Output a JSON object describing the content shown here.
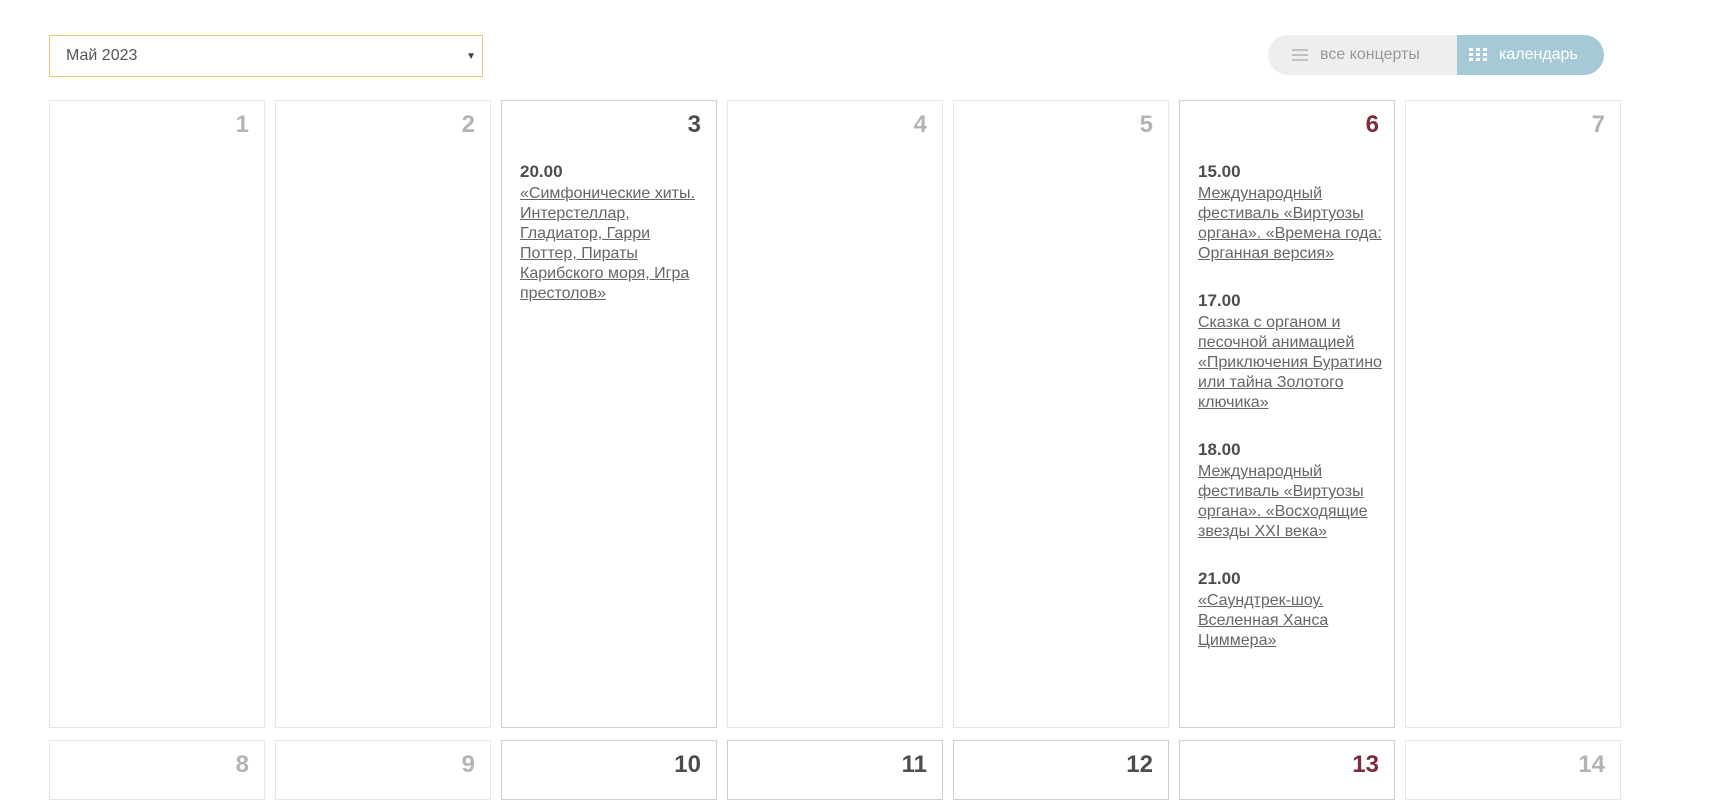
{
  "filter": {
    "month_value": "Май 2023"
  },
  "view_toggle": {
    "all_label": "все концерты",
    "calendar_label": "календарь",
    "active": "calendar"
  },
  "colors": {
    "accent_toggle": "#a6cad5",
    "weekend_day": "#7a2c3a",
    "select_border": "#e8c77c"
  },
  "weeks": [
    [
      {
        "day": "1",
        "events": []
      },
      {
        "day": "2",
        "events": []
      },
      {
        "day": "3",
        "events": [
          {
            "time": "20.00",
            "title": "«Симфонические хиты. Интерстеллар, Гладиатор, Гарри Поттер, Пираты Карибского моря, Игра престолов»"
          }
        ]
      },
      {
        "day": "4",
        "events": []
      },
      {
        "day": "5",
        "events": []
      },
      {
        "day": "6",
        "events": [
          {
            "time": "15.00",
            "title": "Международный фестиваль «Виртуозы органа». «Времена года: Органная версия»"
          },
          {
            "time": "17.00",
            "title": "Сказка с органом и песочной анимацией «Приключения Буратино или тайна Золотого ключика»"
          },
          {
            "time": "18.00",
            "title": "Международный фестиваль «Виртуозы органа». «Восходящие звезды XXI века»"
          },
          {
            "time": "21.00",
            "title": "«Саундтрек-шоу. Вселенная Ханса Циммера»"
          }
        ]
      },
      {
        "day": "7",
        "events": []
      }
    ],
    [
      {
        "day": "8",
        "events": []
      },
      {
        "day": "9",
        "events": []
      },
      {
        "day": "10",
        "events": []
      },
      {
        "day": "11",
        "events": []
      },
      {
        "day": "12",
        "events": []
      },
      {
        "day": "13",
        "events": []
      },
      {
        "day": "14",
        "events": []
      }
    ]
  ]
}
